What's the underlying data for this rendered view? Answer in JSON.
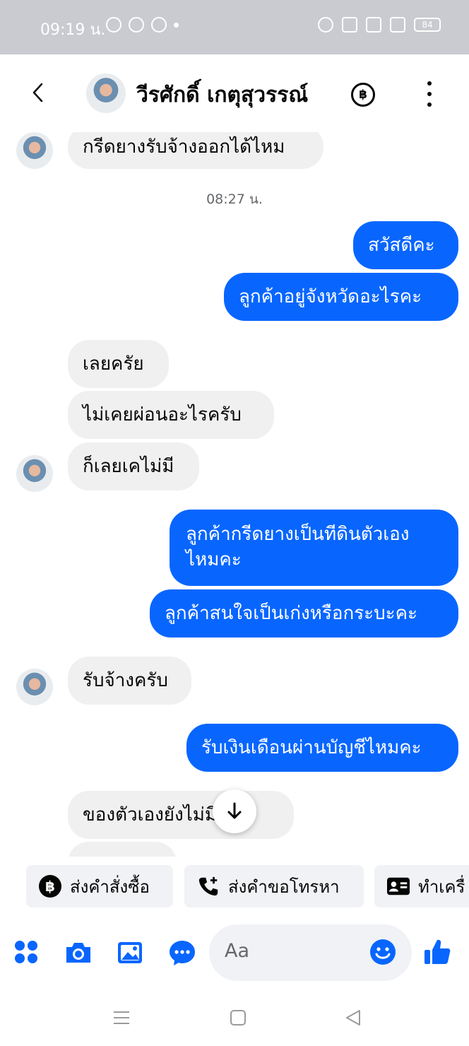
{
  "status_bar": {
    "time": "09:19 น.",
    "battery": "84"
  },
  "header": {
    "contact_name": "วีรศักดิ์ เกตุสุวรรณ์",
    "baht_symbol": "฿"
  },
  "chat": {
    "messages": [
      {
        "side": "in",
        "text": "กรีดยางรับจ้างออกได้ไหม"
      },
      {
        "type": "timestamp",
        "text": "08:27 น."
      },
      {
        "side": "out",
        "text": "สวัสดีคะ"
      },
      {
        "side": "out",
        "text": "ลูกค้าอยู่จังหวัดอะไรคะ"
      },
      {
        "side": "in",
        "text": "เลยครัย"
      },
      {
        "side": "in",
        "text": "ไม่เคยผ่อนอะไรครับ"
      },
      {
        "side": "in",
        "text": "ก็เลยเคไม่มี"
      },
      {
        "side": "out",
        "text": "ลูกค้ากรีดยางเป็นทีดินตัวเอง ไหมคะ"
      },
      {
        "side": "out",
        "text": "ลูกค้าสนใจเป็นเก่งหรือกระบะคะ"
      },
      {
        "side": "in",
        "text": "รับจ้างครับ"
      },
      {
        "side": "out",
        "text": "รับเงินเดือนผ่านบัญชีไหมคะ"
      },
      {
        "side": "in",
        "text": "ของตัวเองยังไม่มีกรีด"
      }
    ]
  },
  "quick_actions": [
    {
      "label": "ส่งคำสั่งซื้อ",
      "icon": "baht-circle-icon"
    },
    {
      "label": "ส่งคำขอโทรหา",
      "icon": "phone-plus-icon"
    },
    {
      "label": "ทำเครื่",
      "icon": "id-card-icon"
    }
  ],
  "composer": {
    "placeholder": "Aa"
  },
  "colors": {
    "accent": "#0866ff",
    "incoming_bubble": "#f0f0f0",
    "status_bar": "#c9cbd0"
  }
}
